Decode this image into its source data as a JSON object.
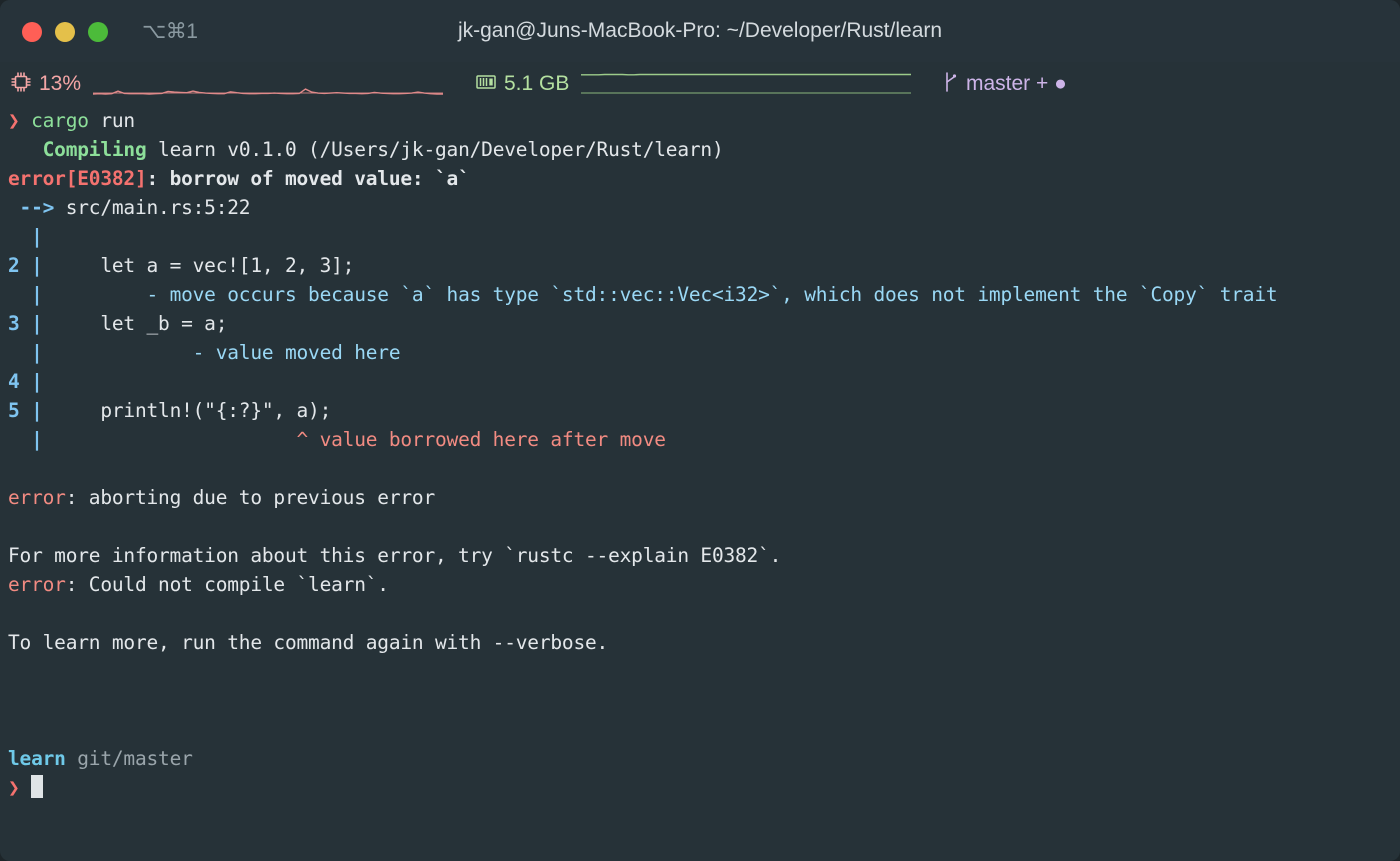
{
  "window": {
    "title": "jk-gan@Juns-MacBook-Pro: ~/Developer/Rust/learn",
    "shortcut_hint": "⌥⌘1",
    "background_color": "#263238",
    "titlebar_color": "#27333a",
    "traffic_lights": [
      {
        "name": "close",
        "color": "#ff5f56"
      },
      {
        "name": "minimize",
        "color": "#e4c04a"
      },
      {
        "name": "maximize",
        "color": "#4cbb3a"
      }
    ]
  },
  "statusbar": {
    "cpu": {
      "icon": "cpu-chip-icon",
      "value": "13%",
      "color": "#f4a6a6"
    },
    "memory": {
      "icon": "ram-stick-icon",
      "value": "5.1 GB",
      "color": "#b4e0a0"
    },
    "git": {
      "icon": "git-branch-icon",
      "value": "master + ●",
      "branch": "master",
      "color": "#cdb4e8"
    }
  },
  "terminal": {
    "lines": [
      {
        "id": "prompt-cmd",
        "segments": [
          {
            "t": "❯ ",
            "c": "c-red c-bold"
          },
          {
            "t": "cargo",
            "c": "c-green"
          },
          {
            "t": " run",
            "c": "c-white"
          }
        ]
      },
      {
        "id": "compiling",
        "segments": [
          {
            "t": "   ",
            "c": "c-white"
          },
          {
            "t": "Compiling",
            "c": "c-green c-bold"
          },
          {
            "t": " learn v0.1.0 (/Users/jk-gan/Developer/Rust/learn)",
            "c": "c-white"
          }
        ]
      },
      {
        "id": "error-head",
        "segments": [
          {
            "t": "error[E0382]",
            "c": "c-red c-bold"
          },
          {
            "t": ": borrow of moved value: `a`",
            "c": "c-white c-bold"
          }
        ]
      },
      {
        "id": "location",
        "segments": [
          {
            "t": " --> ",
            "c": "c-blue c-bold"
          },
          {
            "t": "src/main.rs:5:22",
            "c": "c-white"
          }
        ]
      },
      {
        "id": "bar-1",
        "segments": [
          {
            "t": "  |",
            "c": "c-blue c-bold"
          }
        ]
      },
      {
        "id": "src-2",
        "segments": [
          {
            "t": "2 |",
            "c": "c-blue c-bold"
          },
          {
            "t": "     let a = vec![1, 2, 3];",
            "c": "c-white"
          }
        ]
      },
      {
        "id": "note-2",
        "segments": [
          {
            "t": "  |",
            "c": "c-blue c-bold"
          },
          {
            "t": "         - move occurs because `a` has type `std::vec::Vec<i32>`, which does not implement the `Copy` trait",
            "c": "c-lblue"
          }
        ]
      },
      {
        "id": "src-3",
        "segments": [
          {
            "t": "3 |",
            "c": "c-blue c-bold"
          },
          {
            "t": "     let _b = a;",
            "c": "c-white"
          }
        ]
      },
      {
        "id": "note-3",
        "segments": [
          {
            "t": "  |",
            "c": "c-blue c-bold"
          },
          {
            "t": "             - value moved here",
            "c": "c-lblue"
          }
        ]
      },
      {
        "id": "src-4",
        "segments": [
          {
            "t": "4 |",
            "c": "c-blue c-bold"
          }
        ]
      },
      {
        "id": "src-5",
        "segments": [
          {
            "t": "5 |",
            "c": "c-blue c-bold"
          },
          {
            "t": "     println!(\"{:?}\", a);",
            "c": "c-white"
          }
        ]
      },
      {
        "id": "note-5",
        "segments": [
          {
            "t": "  |",
            "c": "c-blue c-bold"
          },
          {
            "t": "                      ^ value borrowed here after move",
            "c": "c-salmon"
          }
        ]
      },
      {
        "id": "blank-1",
        "segments": []
      },
      {
        "id": "abort",
        "segments": [
          {
            "t": "error",
            "c": "c-salmon"
          },
          {
            "t": ": aborting due to previous error",
            "c": "c-white"
          }
        ]
      },
      {
        "id": "blank-2",
        "segments": []
      },
      {
        "id": "more-info",
        "segments": [
          {
            "t": "For more information about this error, try `rustc --explain E0382`.",
            "c": "c-white"
          }
        ]
      },
      {
        "id": "not-compile",
        "segments": [
          {
            "t": "error",
            "c": "c-salmon"
          },
          {
            "t": ": Could not compile `learn`.",
            "c": "c-white"
          }
        ]
      },
      {
        "id": "blank-3",
        "segments": []
      },
      {
        "id": "verbose",
        "segments": [
          {
            "t": "To learn more, run the command again with --verbose.",
            "c": "c-white"
          }
        ]
      },
      {
        "id": "blank-4",
        "segments": []
      },
      {
        "id": "blank-5",
        "segments": []
      },
      {
        "id": "blank-6",
        "segments": []
      },
      {
        "id": "ps1-dir",
        "segments": [
          {
            "t": "learn",
            "c": "c-cyan c-bold"
          },
          {
            "t": " git/master",
            "c": "c-gray"
          }
        ]
      },
      {
        "id": "ps1-prompt",
        "segments": [
          {
            "t": "❯ ",
            "c": "c-red c-bold"
          }
        ],
        "cursor": true
      }
    ]
  },
  "chart_data": {
    "type": "line",
    "title": "",
    "series": [
      {
        "name": "cpu-sparkline",
        "color": "#e08a8a",
        "values": [
          3,
          4,
          3,
          4,
          12,
          5,
          4,
          4,
          4,
          3,
          4,
          5,
          11,
          9,
          8,
          7,
          12,
          8,
          6,
          5,
          4,
          4,
          10,
          7,
          5,
          4,
          4,
          5,
          5,
          6,
          5,
          4,
          4,
          5,
          18,
          9,
          6,
          5,
          6,
          7,
          6,
          5,
          5,
          4,
          5,
          8,
          6,
          5,
          4,
          4,
          5,
          6,
          9,
          6,
          4,
          3,
          3
        ]
      },
      {
        "name": "memory-sparkline",
        "color": "#9ccc8a",
        "values": [
          62,
          62,
          62,
          62,
          63,
          63,
          63,
          63,
          62,
          62,
          63,
          63,
          63,
          63,
          63,
          63,
          63,
          63,
          63,
          63,
          63,
          63,
          63,
          63,
          63,
          63,
          63,
          63,
          63,
          63,
          63,
          63,
          63,
          63,
          63,
          63,
          63,
          63,
          63,
          63,
          63,
          63,
          63,
          63,
          63,
          63,
          63,
          63,
          63,
          63,
          63,
          63,
          63,
          63,
          63,
          63,
          63
        ]
      }
    ],
    "ylim": [
      0,
      100
    ],
    "xlabel": "",
    "ylabel": ""
  }
}
